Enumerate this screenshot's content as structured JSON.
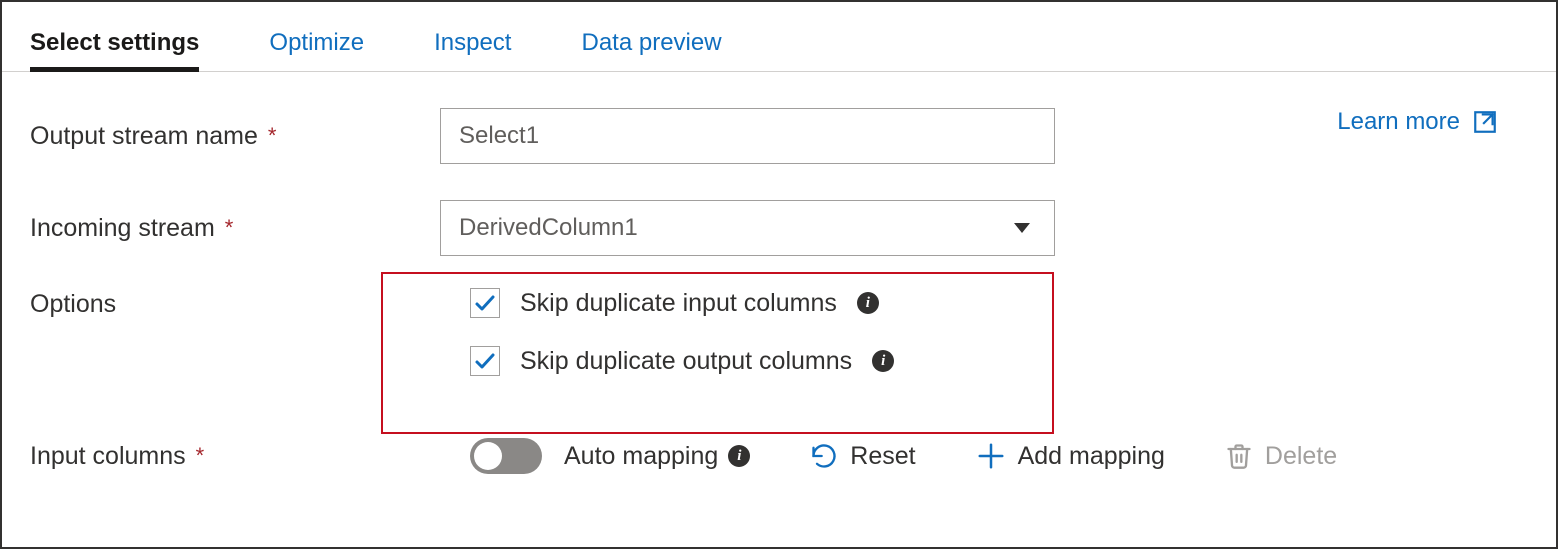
{
  "tabs": {
    "select_settings": "Select settings",
    "optimize": "Optimize",
    "inspect": "Inspect",
    "data_preview": "Data preview"
  },
  "form": {
    "output_stream_label": "Output stream name",
    "output_stream_value": "Select1",
    "incoming_stream_label": "Incoming stream",
    "incoming_stream_value": "DerivedColumn1",
    "options_label": "Options",
    "skip_input": "Skip duplicate input columns",
    "skip_output": "Skip duplicate output columns",
    "input_columns_label": "Input columns",
    "auto_mapping": "Auto mapping",
    "reset": "Reset",
    "add_mapping": "Add mapping",
    "delete": "Delete"
  },
  "learn_more": "Learn more",
  "colors": {
    "link": "#106ebe",
    "highlight_border": "#c50f1f"
  },
  "states": {
    "skip_input_checked": true,
    "skip_output_checked": true,
    "auto_mapping_on": false,
    "delete_enabled": false
  }
}
